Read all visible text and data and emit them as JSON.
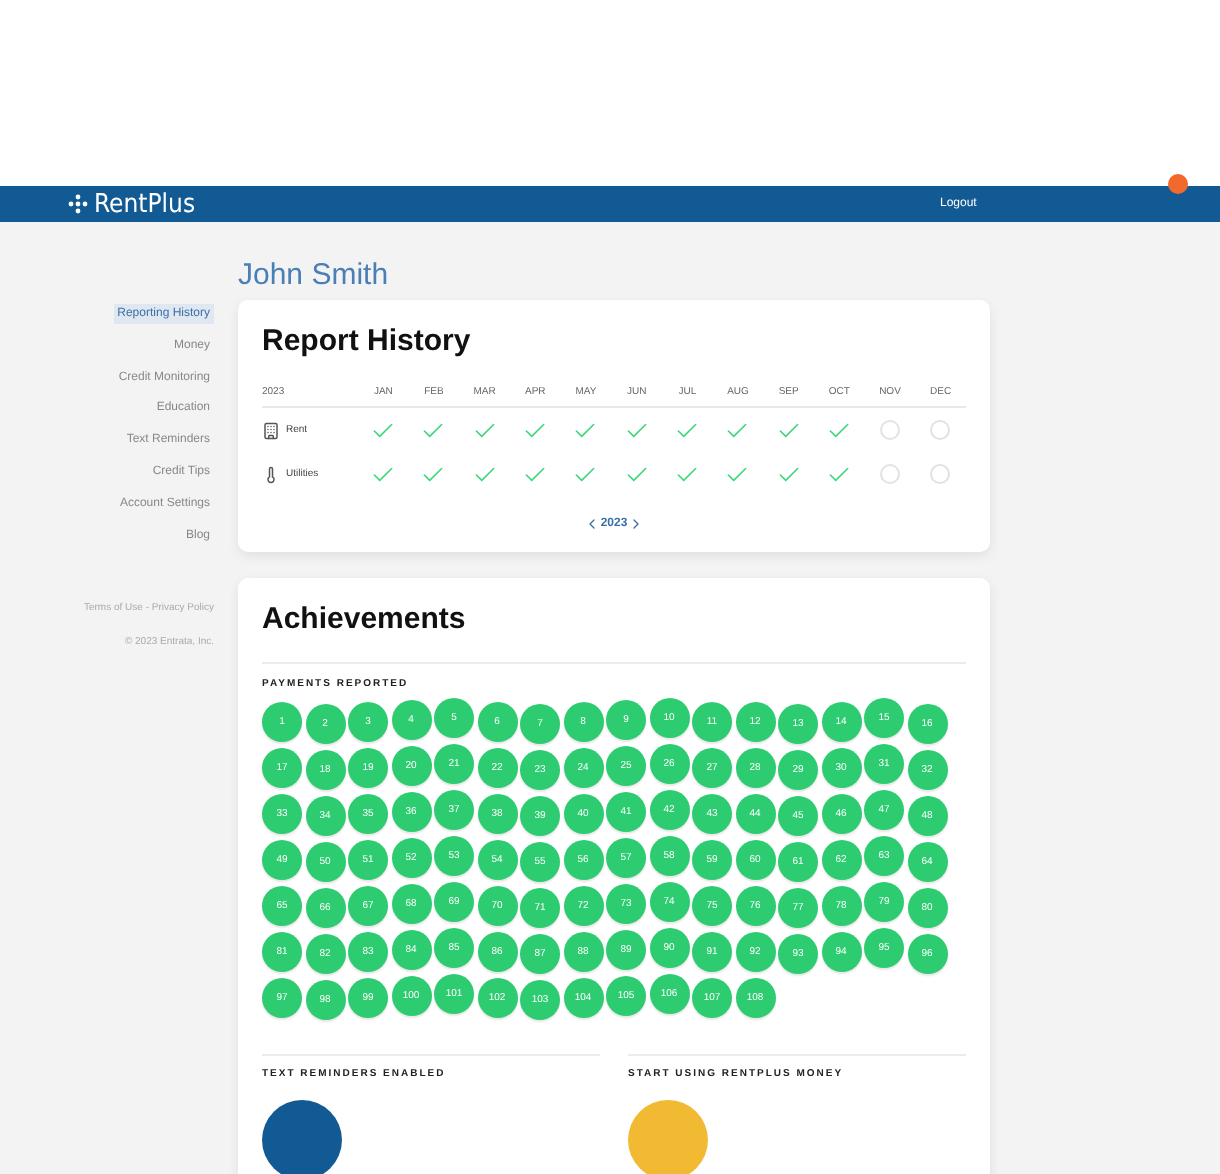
{
  "header": {
    "logo": "RentPlus",
    "logout": "Logout"
  },
  "sidebar": {
    "items": [
      {
        "label": "Reporting History",
        "selected": true
      },
      {
        "label": "Money",
        "selected": false
      },
      {
        "label": "Credit Monitoring",
        "selected": false
      },
      {
        "label": "Education",
        "selected": false
      },
      {
        "label": "Text Reminders",
        "selected": false
      },
      {
        "label": "Credit Tips",
        "selected": false
      },
      {
        "label": "Account Settings",
        "selected": false
      },
      {
        "label": "Blog",
        "selected": false
      }
    ],
    "footer_links": [
      "Terms of Use",
      "Privacy Policy"
    ],
    "footer_separator": "-",
    "copyright": "© 2023 Entrata, Inc."
  },
  "user_name": "John Smith",
  "report": {
    "title": "Report History",
    "year": "2023",
    "months": [
      "JAN",
      "FEB",
      "MAR",
      "APR",
      "MAY",
      "JUN",
      "JUL",
      "AUG",
      "SEP",
      "OCT",
      "NOV",
      "DEC"
    ],
    "rows": [
      {
        "label": "Rent",
        "kind": "building",
        "cells": [
          {
            "checked": true
          },
          {
            "checked": true
          },
          {
            "checked": true
          },
          {
            "checked": true
          },
          {
            "checked": true
          },
          {
            "checked": true
          },
          {
            "checked": true
          },
          {
            "checked": true
          },
          {
            "checked": true
          },
          {
            "checked": true
          },
          {
            "checked": false
          },
          {
            "checked": false
          }
        ]
      },
      {
        "label": "Utilities",
        "kind": "thermometer",
        "cells": [
          {
            "checked": true
          },
          {
            "checked": true
          },
          {
            "checked": true
          },
          {
            "checked": true
          },
          {
            "checked": true
          },
          {
            "checked": true
          },
          {
            "checked": true
          },
          {
            "checked": true
          },
          {
            "checked": true
          },
          {
            "checked": true
          },
          {
            "checked": false
          },
          {
            "checked": false
          }
        ]
      }
    ],
    "pager": "2023"
  },
  "achievements": {
    "title": "Achievements",
    "payments_heading": "PAYMENTS REPORTED",
    "badges": [
      "1",
      "2",
      "3",
      "4",
      "5",
      "6",
      "7",
      "8",
      "9",
      "10",
      "11",
      "12",
      "13",
      "14",
      "15",
      "16",
      "17",
      "18",
      "19",
      "20",
      "21",
      "22",
      "23",
      "24",
      "25",
      "26",
      "27",
      "28",
      "29",
      "30",
      "31",
      "32",
      "33",
      "34",
      "35",
      "36",
      "37",
      "38",
      "39",
      "40",
      "41",
      "42",
      "43",
      "44",
      "45",
      "46",
      "47",
      "48",
      "49",
      "50",
      "51",
      "52",
      "53",
      "54",
      "55",
      "56",
      "57",
      "58",
      "59",
      "60",
      "61",
      "62",
      "63",
      "64",
      "65",
      "66",
      "67",
      "68",
      "69",
      "70",
      "71",
      "72",
      "73",
      "74",
      "75",
      "76",
      "77",
      "78",
      "79",
      "80",
      "81",
      "82",
      "83",
      "84",
      "85",
      "86",
      "87",
      "88",
      "89",
      "90",
      "91",
      "92",
      "93",
      "94",
      "95",
      "96",
      "97",
      "98",
      "99",
      "100",
      "101",
      "102",
      "103",
      "104",
      "105",
      "106",
      "107",
      "108"
    ],
    "sections": [
      {
        "title": "TEXT REMINDERS ENABLED",
        "color": "#125a94"
      },
      {
        "title": "START USING RENTPLUS MONEY",
        "color": "#f2b933"
      }
    ]
  }
}
